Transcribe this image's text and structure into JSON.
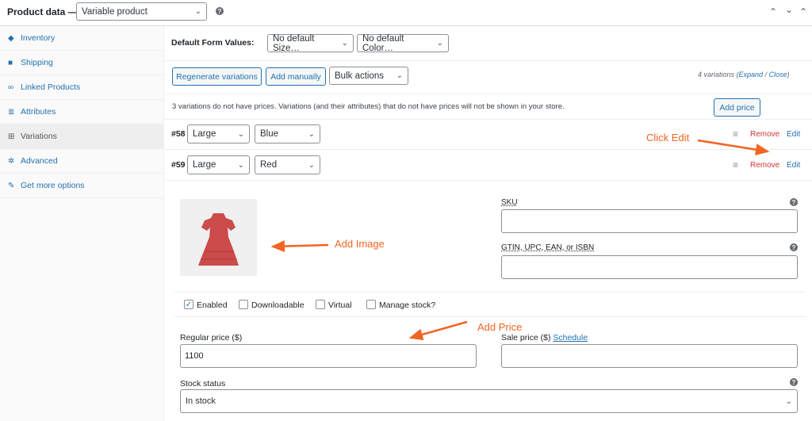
{
  "header": {
    "title": "Product data —",
    "product_type": "Variable product"
  },
  "sidebar": {
    "items": [
      {
        "label": "Inventory",
        "icon": "inventory-icon"
      },
      {
        "label": "Shipping",
        "icon": "truck-icon"
      },
      {
        "label": "Linked Products",
        "icon": "link-icon"
      },
      {
        "label": "Attributes",
        "icon": "list-icon"
      },
      {
        "label": "Variations",
        "icon": "grid-icon"
      },
      {
        "label": "Advanced",
        "icon": "gear-icon"
      },
      {
        "label": "Get more options",
        "icon": "plugin-icon"
      }
    ]
  },
  "defaults": {
    "label": "Default Form Values:",
    "size": "No default Size…",
    "color": "No default Color…"
  },
  "toolbar": {
    "regenerate": "Regenerate variations",
    "add_manually": "Add manually",
    "bulk_actions": "Bulk actions",
    "count": "4 variations",
    "expand": "Expand",
    "separator": "/",
    "close": "Close"
  },
  "notice": {
    "text": "3 variations do not have prices. Variations (and their attributes) that do not have prices will not be shown in your store.",
    "add_price": "Add price"
  },
  "variations": [
    {
      "id": "#58",
      "size": "Large",
      "color": "Blue",
      "remove": "Remove",
      "edit": "Edit"
    },
    {
      "id": "#59",
      "size": "Large",
      "color": "Red",
      "remove": "Remove",
      "edit": "Edit"
    }
  ],
  "form": {
    "sku_label": "SKU",
    "gtin_label": "GTIN, UPC, EAN, or ISBN",
    "enabled": "Enabled",
    "downloadable": "Downloadable",
    "virtual": "Virtual",
    "manage_stock": "Manage stock?",
    "regular_price_label": "Regular price ($)",
    "regular_price_value": "1100",
    "sale_price_label": "Sale price ($)",
    "schedule": "Schedule",
    "stock_status_label": "Stock status",
    "stock_status_value": "In stock"
  },
  "annotations": {
    "click_edit": "Click Edit",
    "add_image": "Add Image",
    "add_price": "Add Price"
  },
  "colors": {
    "accent": "#2271b1",
    "remove": "#d63638",
    "annotation": "#f26522",
    "dress": "#cc4b4b"
  }
}
